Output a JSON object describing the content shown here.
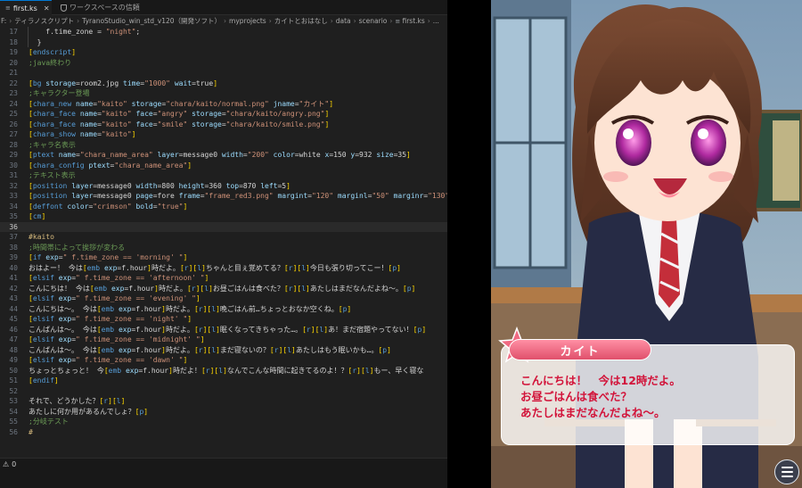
{
  "editor": {
    "tabs": [
      {
        "label": "first.ks",
        "active": true
      },
      {
        "label": "ワークスペースの信頼",
        "active": false
      }
    ],
    "breadcrumb": [
      "F:",
      "ティラノスクリプト",
      "TyranoStudio_win_std_v120（開発ソフト）",
      "myprojects",
      "カイトとおはなし",
      "data",
      "scenario",
      "first.ks",
      "..."
    ],
    "current_line": "36",
    "lines": [
      {
        "n": "17",
        "t": "    f.time_zone = \"night\";"
      },
      {
        "n": "18",
        "t": "  }"
      },
      {
        "n": "19",
        "t": "[endscript]"
      },
      {
        "n": "20",
        "t": ";java終わり"
      },
      {
        "n": "21",
        "t": ""
      },
      {
        "n": "22",
        "t": "[bg storage=room2.jpg time=\"1000\" wait=true]"
      },
      {
        "n": "23",
        "t": ";キャラクター登場"
      },
      {
        "n": "24",
        "t": "[chara_new name=\"kaito\" storage=\"chara/kaito/normal.png\" jname=\"カイト\"]"
      },
      {
        "n": "25",
        "t": "[chara_face name=\"kaito\" face=\"angry\" storage=\"chara/kaito/angry.png\"]"
      },
      {
        "n": "26",
        "t": "[chara_face name=\"kaito\" face=\"smile\" storage=\"chara/kaito/smile.png\"]"
      },
      {
        "n": "27",
        "t": "[chara_show name=\"kaito\"]"
      },
      {
        "n": "28",
        "t": ";キャラ名表示"
      },
      {
        "n": "29",
        "t": "[ptext name=\"chara_name_area\" layer=message0 width=\"200\" color=white x=150 y=932 size=35]"
      },
      {
        "n": "30",
        "t": "[chara_config ptext=\"chara_name_area\"]"
      },
      {
        "n": "31",
        "t": ";テキスト表示"
      },
      {
        "n": "32",
        "t": "[position layer=message0 width=800 height=360 top=870 left=5]"
      },
      {
        "n": "33",
        "t": "[position layer=message0 page=fore frame=\"frame_red3.png\" margint=\"120\" marginl=\"50\" marginr=\"130\""
      },
      {
        "n": "34",
        "t": "[deffont color=\"crimson\" bold=\"true\"]"
      },
      {
        "n": "35",
        "t": "[cm]"
      },
      {
        "n": "36",
        "t": ""
      },
      {
        "n": "37",
        "t": "#kaito"
      },
      {
        "n": "38",
        "t": ";時間帯によって挨拶が変わる"
      },
      {
        "n": "39",
        "t": "[if exp=\" f.time_zone == 'morning' \"]"
      },
      {
        "n": "40",
        "t": "おはよー！ 今は[emb exp=f.hour]時だよ。[r][l]ちゃんと目ぇ覚めてる？[r][l]今日も張り切ってこー！[p]"
      },
      {
        "n": "41",
        "t": "[elsif exp=\" f.time_zone == 'afternoon' \"]"
      },
      {
        "n": "42",
        "t": "こんにちは！ 今は[emb exp=f.hour]時だよ。[r][l]お昼ごはんは食べた？[r][l]あたしはまだなんだよね～。[p]"
      },
      {
        "n": "43",
        "t": "[elsif exp=\" f.time_zone == 'evening' \"]"
      },
      {
        "n": "44",
        "t": "こんにちは～。 今は[emb exp=f.hour]時だよ。[r][l]晩ごはん前…ちょっとおなか空くね。[p]"
      },
      {
        "n": "45",
        "t": "[elsif exp=\" f.time_zone == 'night' \"]"
      },
      {
        "n": "46",
        "t": "こんばんは～。 今は[emb exp=f.hour]時だよ。[r][l]眠くなってきちゃった…。[r][l]あ！まだ宿題やってない！[p]"
      },
      {
        "n": "47",
        "t": "[elsif exp=\" f.time_zone == 'midnight' \"]"
      },
      {
        "n": "48",
        "t": "こんばんは～。 今は[emb exp=f.hour]時だよ。[r][l]まだ寝ないの？[r][l]あたしはもう眠いかも…。[p]"
      },
      {
        "n": "49",
        "t": "[elsif exp=\" f.time_zone == 'dawn' \"]"
      },
      {
        "n": "50",
        "t": "ちょっとちょっと！ 今[emb exp=f.hour]時だよ！[r][l]なんでこんな時間に起きてるのよ！？[r][l]もー、早く寝な"
      },
      {
        "n": "51",
        "t": "[endif]"
      },
      {
        "n": "52",
        "t": ""
      },
      {
        "n": "53",
        "t": "それで、どうかした？[r][l]"
      },
      {
        "n": "54",
        "t": "あたしに何か用があるんでしょ？[p]"
      },
      {
        "n": "55",
        "t": ";分岐テスト"
      },
      {
        "n": "56",
        "t": "#"
      }
    ],
    "status": {
      "problems": "0"
    }
  },
  "game": {
    "speaker": "カイト",
    "message_lines": [
      "こんにちは！　今は12時だよ。",
      "お昼ごはんは食べた？",
      "あたしはまだなんだよね～。"
    ]
  },
  "colors": {
    "tag": "#569cd6",
    "attr": "#9cdcfe",
    "string": "#ce9178",
    "comment": "#6a9955",
    "label": "#d7ba7d",
    "bracket": "#ffd700",
    "message_text": "#d2143a",
    "namebox": "#e0506b"
  }
}
